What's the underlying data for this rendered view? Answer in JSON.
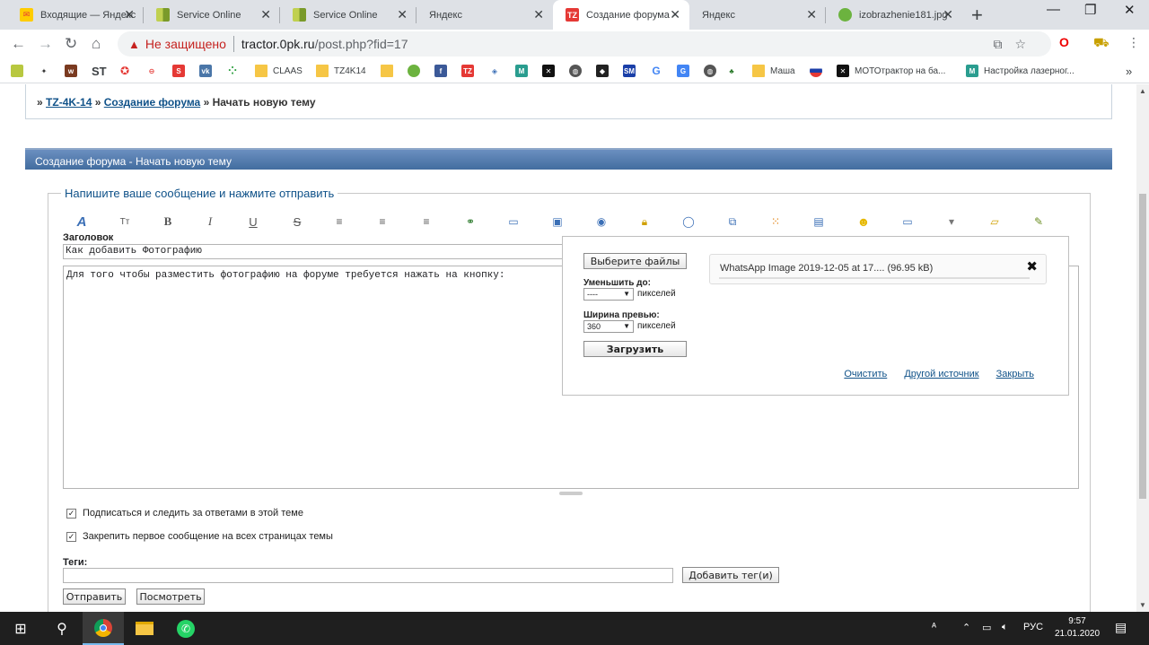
{
  "browser": {
    "tabs": [
      {
        "title": "Входящие — Яндекс",
        "favicon": "mail-icon",
        "color": "#f33"
      },
      {
        "title": "Service Online",
        "favicon": "service-icon",
        "color": "#a8c040"
      },
      {
        "title": "Service Online",
        "favicon": "service-icon",
        "color": "#a8c040"
      },
      {
        "title": "Яндекс",
        "favicon": "",
        "color": ""
      },
      {
        "title": "Создание форума -",
        "favicon": "tz-icon",
        "color": "#e53935"
      },
      {
        "title": "Яндекс",
        "favicon": "",
        "color": ""
      },
      {
        "title": "izobrazhenie181.jpg",
        "favicon": "apple-icon",
        "color": "#6cb33f"
      }
    ],
    "active_tab_index": 4,
    "new_tab_label": "+",
    "security_label": "Не защищено",
    "url_host": "tractor.0pk.ru",
    "url_path": "/post.php?fid=17",
    "bookmarks": [
      {
        "label": "ST",
        "kind": "text"
      },
      {
        "label": "CLAAS",
        "kind": "folder"
      },
      {
        "label": "TZ4K14",
        "kind": "folder"
      },
      {
        "label": "Маша",
        "kind": "folder"
      },
      {
        "label": "МОТОтрактор на ба...",
        "kind": "site"
      },
      {
        "label": "Настройка лазерног...",
        "kind": "site"
      }
    ],
    "bookmarks_more": "»"
  },
  "page": {
    "breadcrumb": {
      "sep": "»",
      "link1": "TZ-4K-14",
      "link2": "Создание форума",
      "current": "Начать новую тему"
    },
    "panel_title": "Создание форума - Начать новую тему",
    "legend": "Напишите ваше сообщение и нажмите отправить",
    "subject_label": "Заголовок",
    "subject_value": "Как добавить Фотографию",
    "message_value": "Для того чтобы разместить фотографию на форуме требуется нажать на кнопку:",
    "subscribe_label": "Подписаться и следить за ответами в этой теме",
    "pin_label": "Закрепить первое сообщение на всех страницах темы",
    "tags_label": "Теги:",
    "add_tags_button": "Добавить тег(и)",
    "submit_button": "Отправить",
    "preview_button": "Посмотреть"
  },
  "upload_popup": {
    "choose_files": "Выберите файлы",
    "reduce_label": "Уменьшить до:",
    "reduce_value": "----",
    "preview_width_label": "Ширина превью:",
    "preview_width_value": "360",
    "unit": "пикселей",
    "upload_button": "Загрузить",
    "file_name": "WhatsApp Image 2019-12-05 at 17.... (96.95 kB)",
    "link_clear": "Очистить",
    "link_other_source": "Другой источник",
    "link_close": "Закрыть"
  },
  "taskbar": {
    "language": "РУС",
    "time": "9:57",
    "date": "21.01.2020"
  }
}
